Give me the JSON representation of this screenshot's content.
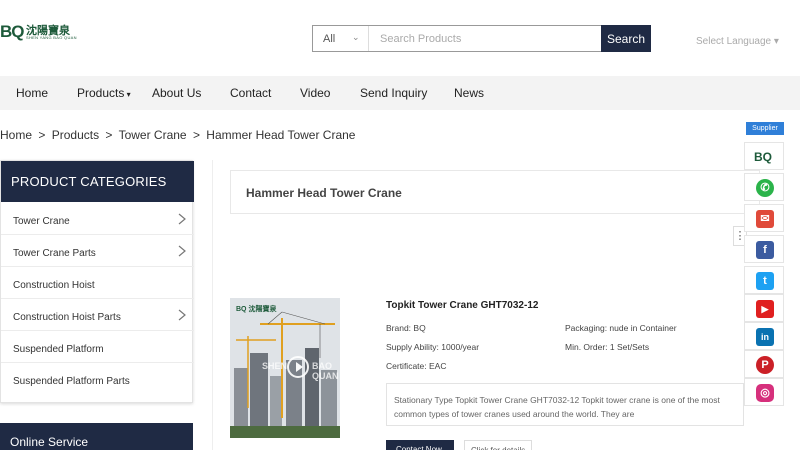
{
  "logo": {
    "mark": "BQ",
    "cn": "沈陽寶泉",
    "sub": "SHEN YANG BAO QUAN"
  },
  "search": {
    "category": "All",
    "placeholder": "Search Products",
    "button": "Search"
  },
  "language": "Select Language",
  "nav": [
    "Home",
    "Products",
    "About Us",
    "Contact",
    "Video",
    "Send Inquiry",
    "News"
  ],
  "breadcrumb": [
    "Home",
    ">",
    "Products",
    ">",
    "Tower Crane",
    ">",
    "Hammer Head Tower Crane"
  ],
  "sidebar": {
    "heading": "PRODUCT CATEGORIES",
    "items": [
      {
        "label": "Tower Crane",
        "has_arrow": true
      },
      {
        "label": "Tower Crane Parts",
        "has_arrow": true
      },
      {
        "label": "Construction Hoist",
        "has_arrow": false
      },
      {
        "label": "Construction Hoist Parts",
        "has_arrow": true
      },
      {
        "label": "Suspended Platform",
        "has_arrow": false
      },
      {
        "label": "Suspended Platform Parts",
        "has_arrow": false
      }
    ],
    "online_service": "Online Service"
  },
  "main": {
    "title": "Hammer Head Tower Crane",
    "product": {
      "name": "Topkit Tower Crane GHT7032-12",
      "thumb_logo": "BQ 沈陽寶泉",
      "watermark_left": "SHEN",
      "watermark_right": "BAO QUAN",
      "brand": "Brand: BQ",
      "packaging": "Packaging: nude in Container",
      "supply": "Supply Ability: 1000/year",
      "min_order": "Min. Order: 1 Set/Sets",
      "certificate": "Certificate: EAC",
      "description": "Stationary Type Topkit Tower Crane GHT7032-12 Topkit tower crane is one of the most common types of tower cranes used around the world. They are",
      "contact_btn": "Contact Now",
      "detail_btn": "Click for details"
    }
  },
  "social": {
    "supplier": "Supplier",
    "items": [
      {
        "name": "bq",
        "glyph": "BQ",
        "color": "#1d5a3a"
      },
      {
        "name": "whatsapp",
        "glyph": "✆",
        "color": "#2bb34a"
      },
      {
        "name": "email",
        "glyph": "✉",
        "color": "#e04a3a"
      },
      {
        "name": "facebook",
        "glyph": "f",
        "color": "#3b5ba0"
      },
      {
        "name": "twitter",
        "glyph": "t",
        "color": "#1da1f2"
      },
      {
        "name": "youtube",
        "glyph": "▶",
        "color": "#e02020"
      },
      {
        "name": "linkedin",
        "glyph": "in",
        "color": "#0a72b1"
      },
      {
        "name": "pinterest",
        "glyph": "P",
        "color": "#cb2027"
      },
      {
        "name": "instagram",
        "glyph": "◎",
        "color": "#d6307c"
      }
    ]
  }
}
